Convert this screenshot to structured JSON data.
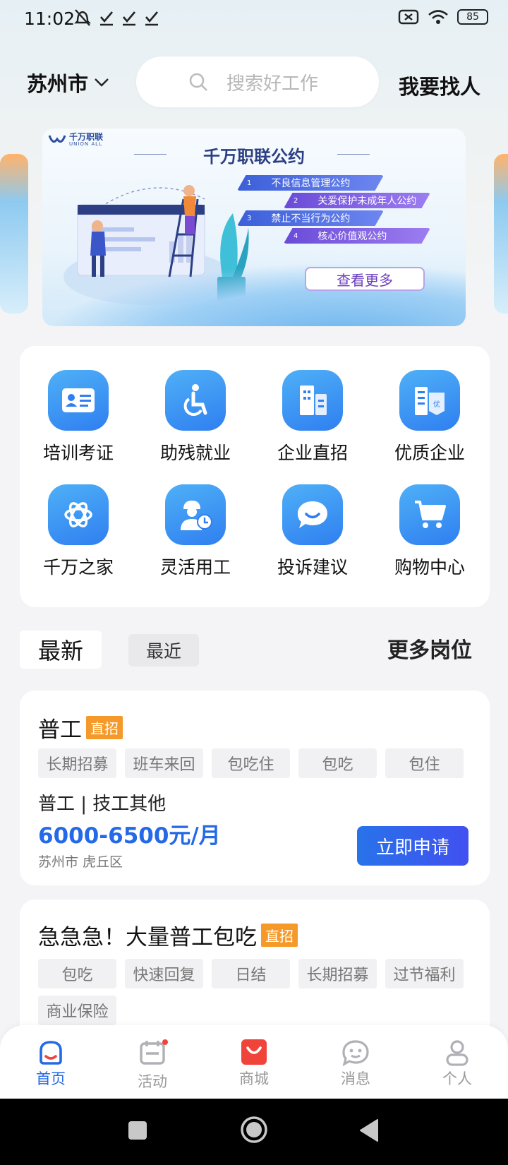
{
  "status_bar": {
    "time": "11:02",
    "battery": "85"
  },
  "header": {
    "city": "苏州市",
    "search_placeholder": "搜索好工作",
    "find_people": "我要找人"
  },
  "banner": {
    "logo_text": "千万职联",
    "logo_sub": "UNION ALL",
    "title": "千万职联公约",
    "items": [
      {
        "num": "1",
        "label": "不良信息管理公约"
      },
      {
        "num": "2",
        "label": "关爱保护未成年人公约"
      },
      {
        "num": "3",
        "label": "禁止不当行为公约"
      },
      {
        "num": "4",
        "label": "核心价值观公约"
      }
    ],
    "more_label": "查看更多"
  },
  "grid": {
    "items": [
      {
        "label": "培训考证",
        "icon": "id-card-icon"
      },
      {
        "label": "助残就业",
        "icon": "wheelchair-icon"
      },
      {
        "label": "企业直招",
        "icon": "building-icon"
      },
      {
        "label": "优质企业",
        "icon": "quality-building-icon"
      },
      {
        "label": "千万之家",
        "icon": "knot-icon"
      },
      {
        "label": "灵活用工",
        "icon": "worker-clock-icon"
      },
      {
        "label": "投诉建议",
        "icon": "chat-bubble-icon"
      },
      {
        "label": "购物中心",
        "icon": "cart-icon"
      }
    ]
  },
  "tabs": {
    "latest": "最新",
    "nearby": "最近",
    "more_jobs": "更多岗位"
  },
  "jobs": [
    {
      "title": "普工",
      "badge": "直招",
      "tags": [
        "长期招募",
        "班车来回",
        "包吃住",
        "包吃",
        "包住"
      ],
      "category": "普工 | 技工其他",
      "salary": "6000-6500元/月",
      "location": "苏州市 虎丘区",
      "apply_label": "立即申请"
    },
    {
      "title": "急急急！大量普工包吃",
      "badge": "直招",
      "tags": [
        "包吃",
        "快速回复",
        "日结",
        "长期招募",
        "过节福利",
        "商业保险"
      ]
    }
  ],
  "bottom_nav": {
    "items": [
      {
        "label": "首页",
        "icon": "home-icon"
      },
      {
        "label": "活动",
        "icon": "calendar-icon"
      },
      {
        "label": "商城",
        "icon": "shop-bag-icon"
      },
      {
        "label": "消息",
        "icon": "message-icon"
      },
      {
        "label": "个人",
        "icon": "person-icon"
      }
    ]
  },
  "colors": {
    "accent": "#2469e6",
    "badge": "#f59a2a",
    "mall": "#f0443a"
  }
}
